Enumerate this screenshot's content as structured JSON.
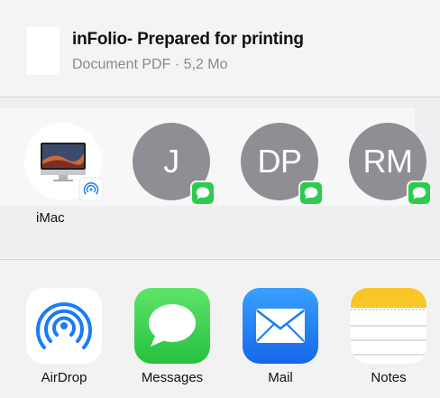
{
  "document": {
    "title": "inFolio- Prepared for printing",
    "subtitle": "Document PDF · 5,2 Mo"
  },
  "contacts": [
    {
      "label": "iMac",
      "initials": "",
      "type": "airdrop-device"
    },
    {
      "label": "",
      "initials": "J",
      "type": "message"
    },
    {
      "label": "",
      "initials": "DP",
      "type": "message"
    },
    {
      "label": "",
      "initials": "RM",
      "type": "message"
    }
  ],
  "apps": [
    {
      "label": "AirDrop",
      "icon": "airdrop-icon"
    },
    {
      "label": "Messages",
      "icon": "messages-icon"
    },
    {
      "label": "Mail",
      "icon": "mail-icon"
    },
    {
      "label": "Notes",
      "icon": "notes-icon"
    }
  ],
  "colors": {
    "messages_green": "#2bcc4e",
    "mail_blue": "#1a7cf5",
    "avatar_gray": "#8e8e94",
    "notes_yellow": "#f9c62a"
  }
}
